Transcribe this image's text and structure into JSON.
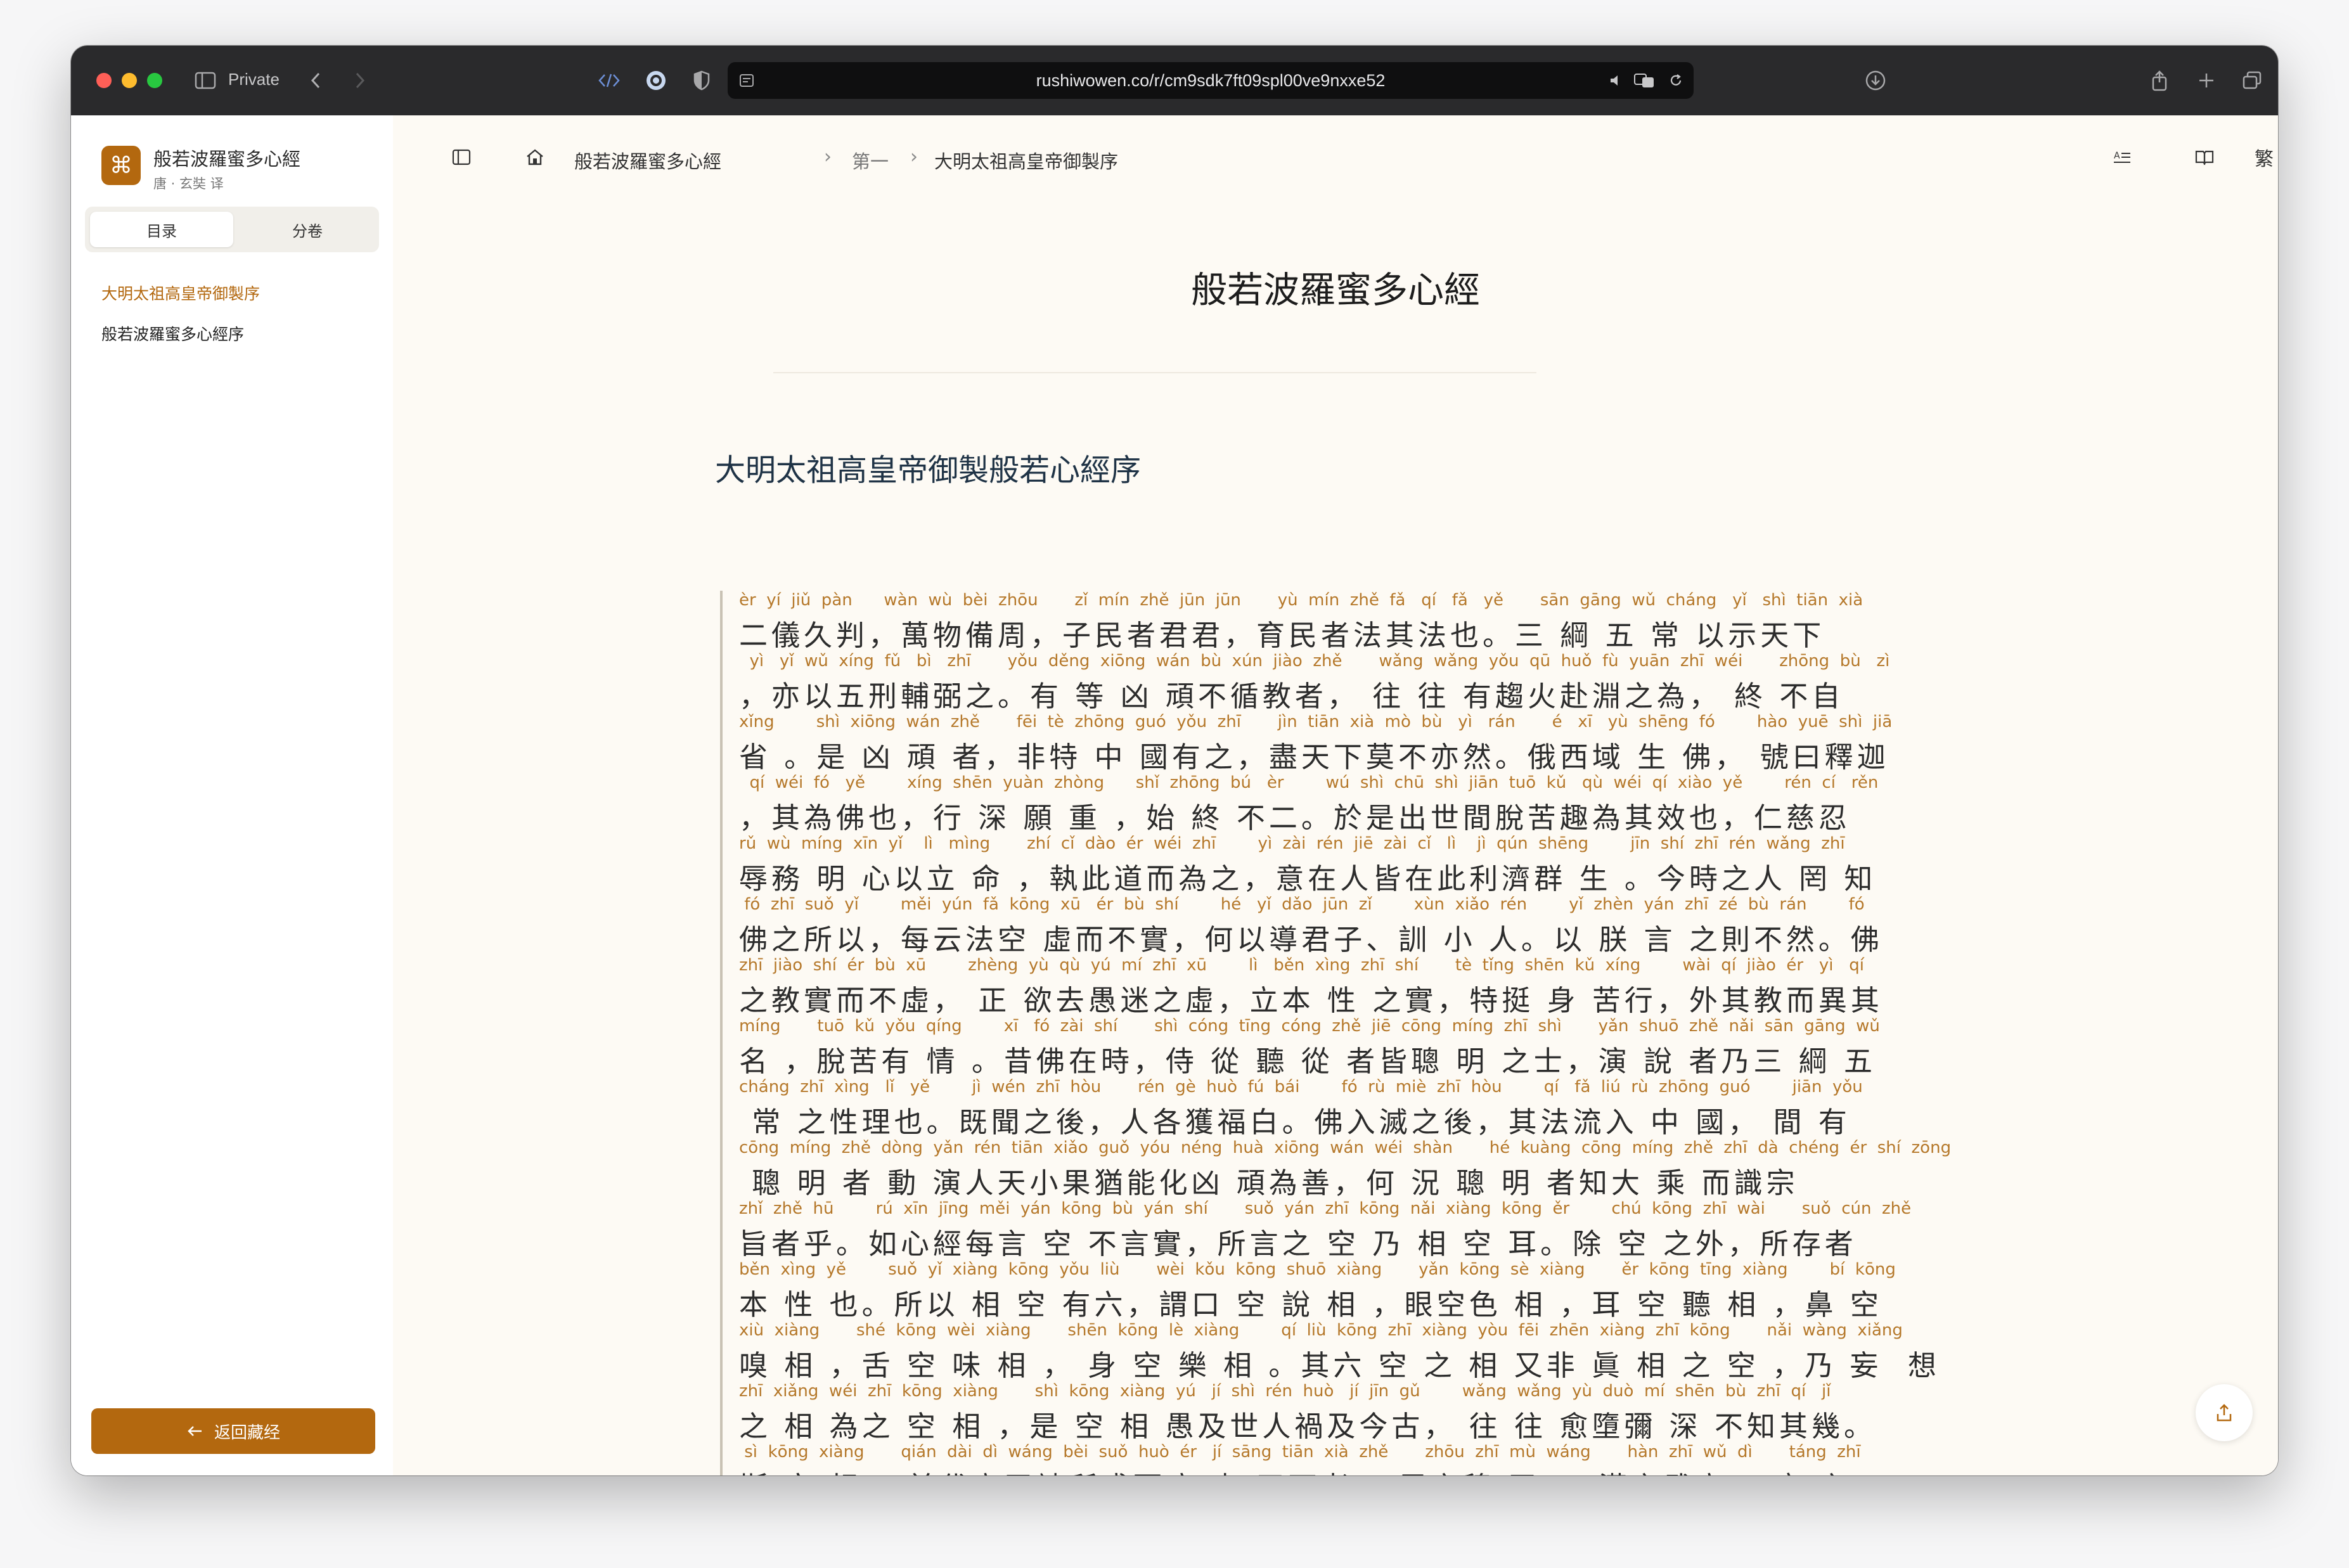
{
  "browser": {
    "private_label": "Private",
    "url": "rushiwowen.co/r/cm9sdk7ft09spl00ve9nxxe52"
  },
  "sidebar": {
    "book_title": "般若波羅蜜多心經",
    "book_subtitle": "唐 · 玄奘 译",
    "tabs": [
      "目录",
      "分卷"
    ],
    "toc": [
      {
        "label": "大明太祖高皇帝御製序",
        "active": true
      },
      {
        "label": "般若波羅蜜多心經序",
        "active": false
      }
    ],
    "back_label": "返回藏经"
  },
  "breadcrumb": {
    "items": [
      "般若波羅蜜多心經",
      "第一",
      "大明太祖高皇帝御製序"
    ]
  },
  "toolbar": {
    "trad_label": "繁"
  },
  "doc": {
    "title": "般若波羅蜜多心經",
    "section_title": "大明太祖高皇帝御製般若心經序",
    "lines": [
      {
        "py": "èr  yí  jiǔ  pàn      wàn  wù  bèi  zhōu       zǐ  mín  zhě  jūn  jūn       yù  mín  zhě  fǎ   qí   fǎ   yě       sān  gāng  wǔ  cháng   yǐ   shì  tiān  xià",
        "zh": "二儀久判，萬物備周，子民者君君，育民者法其法也。三 綱 五 常 以示天下"
      },
      {
        "py": "  yì   yǐ  wǔ  xíng  fǔ   bì   zhī       yǒu  děng  xiōng  wán  bù  xún  jiào  zhě       wǎng  wǎng  yǒu  qū  huǒ  fù  yuān  zhī  wéi       zhōng  bù   zì",
        "zh": "，亦以五刑輔弼之。有 等 凶 頑不循教者， 往 往 有趨火赴淵之為， 終 不自"
      },
      {
        "py": "xǐng        shì  xiōng  wán  zhě       fēi  tè  zhōng  guó  yǒu  zhī       jìn  tiān  xià  mò  bù   yì   rán       é   xī   yù  shēng  fó        hào  yuē  shì  jiā",
        "zh": "省 。是 凶 頑 者，非特 中 國有之，盡天下莫不亦然。俄西域 生 佛， 號曰釋迦"
      },
      {
        "py": "  qí  wéi  fó   yě        xíng  shēn  yuàn  zhòng      shǐ  zhōng  bú   èr        wú  shì  chū  shì  jiān  tuō  kǔ   qù  wéi  qí  xiào  yě        rén  cí   rěn",
        "zh": "，其為佛也，行 深 願 重 ，始 終 不二。於是出世間脫苦趣為其效也，仁慈忍"
      },
      {
        "py": "rǔ  wù  míng  xīn  yǐ    lì   mìng       zhí  cǐ  dào  ér  wéi  zhī        yì  zài  rén  jiē  zài  cǐ   lì    jì  qún  shēng        jīn  shí  zhī  rén  wǎng  zhī",
        "zh": "辱務 明 心以立 命 ，執此道而為之，意在人皆在此利濟群 生 。今時之人 罔 知"
      },
      {
        "py": " fó  zhī  suǒ  yǐ        měi  yún  fǎ  kōng  xū   ér  bù  shí        hé   yǐ  dǎo  jūn  zǐ        xùn  xiǎo  rén        yǐ  zhèn  yán  zhī  zé  bù  rán        fó",
        "zh": "佛之所以，每云法空 虛而不實，何以導君子、訓 小 人。以 朕 言 之則不然。佛"
      },
      {
        "py": "zhī  jiào  shí  ér  bù  xū        zhèng  yù  qù  yú  mí  zhī  xū        lì   běn  xìng  zhī  shí       tè  tǐng  shēn  kǔ  xíng        wài  qí  jiào  ér   yì   qí",
        "zh": "之教實而不虛， 正 欲去愚迷之虛，立本 性 之實，特挺 身 苦行，外其教而異其"
      },
      {
        "py": "míng       tuō  kǔ  yǒu  qíng        xī   fó  zài  shí       shì  cóng  tīng  cóng  zhě  jiē  cōng  míng  zhī  shì       yǎn  shuō  zhě  nǎi  sān  gāng  wǔ",
        "zh": "名 ，脫苦有 情 。昔佛在時，侍 從 聽 從 者皆聰 明 之士，演 說 者乃三 綱 五"
      },
      {
        "py": "cháng  zhī  xìng   lǐ   yě        jì  wén  zhī  hòu       rén  gè  huò  fú  bái        fó  rù  miè  zhī  hòu        qí   fǎ  liú  rù  zhōng  guó        jiān  yǒu",
        "zh": " 常 之性理也。既聞之後，人各獲福白。佛入滅之後，其法流入 中 國， 間 有"
      },
      {
        "py": "cōng  míng  zhě  dòng  yǎn  rén  tiān  xiǎo  guǒ  yóu  néng  huà  xiōng  wán  wéi  shàn       hé  kuàng  cōng  míng  zhě  zhī  dà  chéng  ér  shí  zōng",
        "zh": " 聰 明 者 動 演人天小果猶能化凶 頑為善，何 況 聰 明 者知大 乘 而識宗"
      },
      {
        "py": "zhǐ  zhě  hū        rú  xīn  jīng  měi  yán  kōng  bù  yán  shí       suǒ  yán  zhī  kōng  nǎi  xiàng  kōng  ěr        chú  kōng  zhī  wài       suǒ  cún  zhě",
        "zh": "旨者乎。如心經每言 空 不言實，所言之 空 乃 相 空 耳。除 空 之外，所存者"
      },
      {
        "py": "běn  xìng  yě        suǒ  yǐ  xiàng  kōng  yǒu  liù       wèi  kǒu  kōng  shuō  xiàng       yǎn  kōng  sè  xiàng       ěr  kōng  tīng  xiàng        bí  kōng",
        "zh": "本 性 也。所以 相 空 有六，謂口 空 說 相 ，眼空色 相 ，耳 空 聽 相 ，鼻 空"
      },
      {
        "py": "xiù  xiàng       shé  kōng  wèi  xiàng       shēn  kōng  lè  xiàng        qí  liù  kōng  zhī  xiàng  yòu  fēi  zhēn  xiàng  zhī  kōng       nǎi  wàng  xiǎng",
        "zh": "嗅 相 ，舌 空 味 相 ， 身 空 樂 相 。其六 空 之 相 又非 眞 相 之 空 ，乃 妄  想"
      },
      {
        "py": "zhī  xiǎng  wéi  zhī  kōng  xiàng       shì  kōng  xiàng  yú   jí  shì  rén  huò   jí  jīn  gǔ        wǎng  wǎng  yù  duò  mí  shēn  bù  zhī  qí   jǐ",
        "zh": "之 相 為之 空 相 ，是 空 相 愚及世人禍及今古， 往 往 愈墮彌 深 不知其幾。"
      },
      {
        "py": " sì  kōng  xiàng       qián  dài  dì  wáng  bèi  suǒ  huò  ér   jí  sāng  tiān  xià  zhě       zhōu  zhī  mù  wáng       hàn  zhī  wǔ  dì       táng  zhī",
        "zh": "斯 空 相 ，前代帝王被所惑而疾 喪 天下者， 周之穆 王 ， 漢之武帝， 唐 之"
      }
    ]
  }
}
